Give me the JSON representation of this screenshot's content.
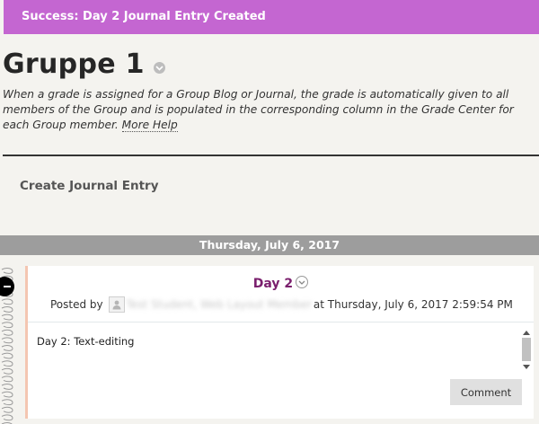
{
  "banner": {
    "text": "Success: Day 2 Journal Entry Created",
    "color": "#c466d1"
  },
  "page": {
    "title": "Gruppe 1",
    "description": "When a grade is assigned for a Group Blog or Journal, the grade is automatically given to all members of the Group and is populated in the corresponding column in the Grade Center for each Group member.",
    "more_help": "More Help"
  },
  "actions": {
    "create_entry": "Create Journal Entry"
  },
  "date_header": "Thursday, July 6, 2017",
  "entry": {
    "title": "Day 2",
    "posted_by_label": "Posted by",
    "author": "Test Student, Web Layout Member",
    "timestamp": "at Thursday, July 6, 2017 2:59:54 PM",
    "body": "Day 2: Text-editing",
    "comment_label": "Comment",
    "title_color": "#7a1f6d"
  },
  "icons": {
    "title_menu": "chevron-down-icon",
    "entry_menu": "chevron-down-icon",
    "avatar": "user-icon",
    "collapse": "minus-icon"
  }
}
